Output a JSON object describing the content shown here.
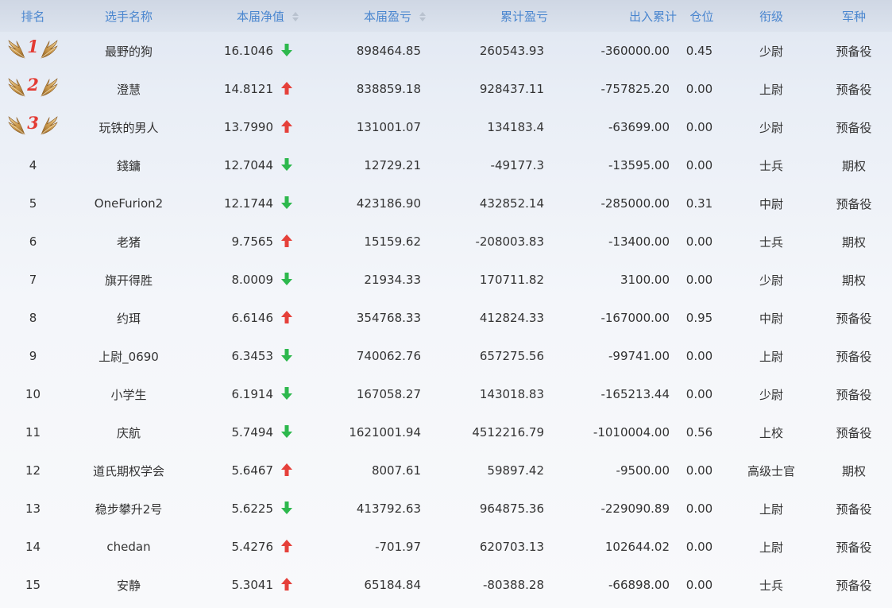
{
  "headers": {
    "rank": "排名",
    "name": "选手名称",
    "nav": "本届净值",
    "pl": "本届盈亏",
    "cum": "累计盈亏",
    "flow": "出入累计",
    "pos": "仓位",
    "grade": "衔级",
    "branch": "军种"
  },
  "icons": {
    "sort": "sort-icon",
    "up": "arrow-up-icon",
    "down": "arrow-down-icon",
    "medal": "laurel-wing-icon"
  },
  "colors": {
    "header_text": "#4a86cf",
    "up": "#e5403a",
    "down": "#2db84d",
    "medal_number": "#e33b33"
  },
  "rows": [
    {
      "rank": "1",
      "name": "最野的狗",
      "nav": "16.1046",
      "trend": "down",
      "pl": "898464.85",
      "cum": "260543.93",
      "flow": "-360000.00",
      "pos": "0.45",
      "grade": "少尉",
      "branch": "预备役"
    },
    {
      "rank": "2",
      "name": "澄慧",
      "nav": "14.8121",
      "trend": "up",
      "pl": "838859.18",
      "cum": "928437.11",
      "flow": "-757825.20",
      "pos": "0.00",
      "grade": "上尉",
      "branch": "预备役"
    },
    {
      "rank": "3",
      "name": "玩铁的男人",
      "nav": "13.7990",
      "trend": "up",
      "pl": "131001.07",
      "cum": "134183.4",
      "flow": "-63699.00",
      "pos": "0.00",
      "grade": "少尉",
      "branch": "预备役"
    },
    {
      "rank": "4",
      "name": "錢鏞",
      "nav": "12.7044",
      "trend": "down",
      "pl": "12729.21",
      "cum": "-49177.3",
      "flow": "-13595.00",
      "pos": "0.00",
      "grade": "士兵",
      "branch": "期权"
    },
    {
      "rank": "5",
      "name": "OneFurion2",
      "nav": "12.1744",
      "trend": "down",
      "pl": "423186.90",
      "cum": "432852.14",
      "flow": "-285000.00",
      "pos": "0.31",
      "grade": "中尉",
      "branch": "预备役"
    },
    {
      "rank": "6",
      "name": "老猪",
      "nav": "9.7565",
      "trend": "up",
      "pl": "15159.62",
      "cum": "-208003.83",
      "flow": "-13400.00",
      "pos": "0.00",
      "grade": "士兵",
      "branch": "期权"
    },
    {
      "rank": "7",
      "name": "旗开得胜",
      "nav": "8.0009",
      "trend": "down",
      "pl": "21934.33",
      "cum": "170711.82",
      "flow": "3100.00",
      "pos": "0.00",
      "grade": "少尉",
      "branch": "期权"
    },
    {
      "rank": "8",
      "name": "约珥",
      "nav": "6.6146",
      "trend": "up",
      "pl": "354768.33",
      "cum": "412824.33",
      "flow": "-167000.00",
      "pos": "0.95",
      "grade": "中尉",
      "branch": "预备役"
    },
    {
      "rank": "9",
      "name": "上尉_0690",
      "nav": "6.3453",
      "trend": "down",
      "pl": "740062.76",
      "cum": "657275.56",
      "flow": "-99741.00",
      "pos": "0.00",
      "grade": "上尉",
      "branch": "预备役"
    },
    {
      "rank": "10",
      "name": "小学生",
      "nav": "6.1914",
      "trend": "down",
      "pl": "167058.27",
      "cum": "143018.83",
      "flow": "-165213.44",
      "pos": "0.00",
      "grade": "少尉",
      "branch": "预备役"
    },
    {
      "rank": "11",
      "name": "庆航",
      "nav": "5.7494",
      "trend": "down",
      "pl": "1621001.94",
      "cum": "4512216.79",
      "flow": "-1010004.00",
      "pos": "0.56",
      "grade": "上校",
      "branch": "预备役"
    },
    {
      "rank": "12",
      "name": "道氏期权学会",
      "nav": "5.6467",
      "trend": "up",
      "pl": "8007.61",
      "cum": "59897.42",
      "flow": "-9500.00",
      "pos": "0.00",
      "grade": "高级士官",
      "branch": "期权"
    },
    {
      "rank": "13",
      "name": "稳步攀升2号",
      "nav": "5.6225",
      "trend": "down",
      "pl": "413792.63",
      "cum": "964875.36",
      "flow": "-229090.89",
      "pos": "0.00",
      "grade": "上尉",
      "branch": "预备役"
    },
    {
      "rank": "14",
      "name": "chedan",
      "nav": "5.4276",
      "trend": "up",
      "pl": "-701.97",
      "cum": "620703.13",
      "flow": "102644.02",
      "pos": "0.00",
      "grade": "上尉",
      "branch": "预备役"
    },
    {
      "rank": "15",
      "name": "安静",
      "nav": "5.3041",
      "trend": "up",
      "pl": "65184.84",
      "cum": "-80388.28",
      "flow": "-66898.00",
      "pos": "0.00",
      "grade": "士兵",
      "branch": "预备役"
    }
  ]
}
